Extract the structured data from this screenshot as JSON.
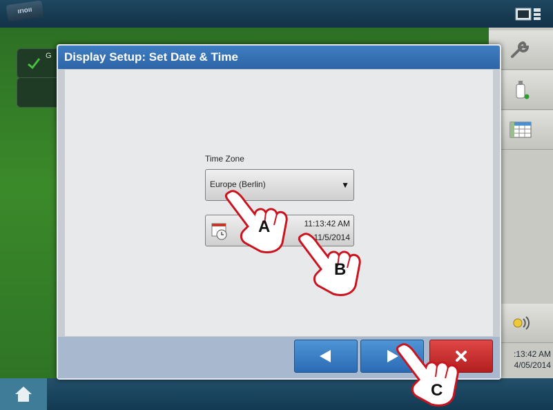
{
  "header": {
    "logo_text": "ırıoıı"
  },
  "background": {
    "partial_label": "G"
  },
  "dialog": {
    "title": "Display Setup: Set Date & Time",
    "time_zone_label": "Time Zone",
    "time_zone_value": "Europe (Berlin)",
    "time": "11:13:42 AM",
    "date": "11/5/2014"
  },
  "sidebar_clock": {
    "time": ":13:42 AM",
    "date": "4/05/2014"
  },
  "callouts": {
    "a": "A",
    "b": "B",
    "c": "C"
  },
  "icons": [
    "screen-layout-icon",
    "wrench-icon",
    "bottle-icon",
    "grid-icon",
    "wireless-icon",
    "calendar-clock-icon",
    "back-arrow-icon",
    "forward-arrow-icon",
    "close-icon",
    "home-icon",
    "pointing-hand-icon"
  ],
  "colors": {
    "title_blue": "#2d64a7",
    "nav_blue": "#2b6bb4",
    "cancel_red": "#b31e1e",
    "field_green": "#3b8a2a"
  }
}
